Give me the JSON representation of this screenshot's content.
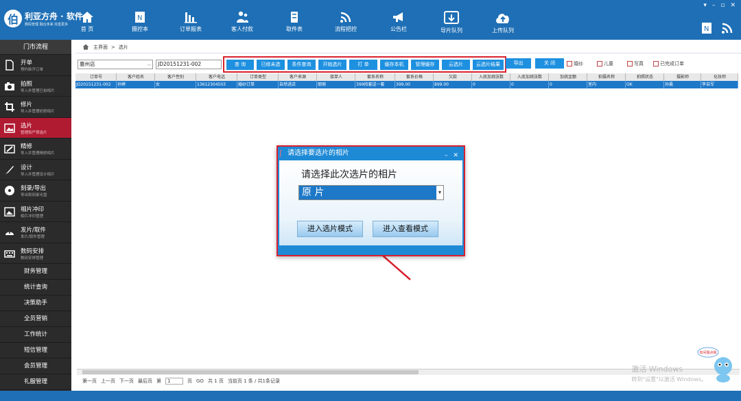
{
  "window": {
    "logo_char": "伯",
    "app_name": "利亚方舟 · 软件",
    "app_slogan": "数码管理 融合未来 完善更多",
    "controls": [
      "▾",
      "–",
      "▫",
      "✕"
    ]
  },
  "nav": [
    {
      "label": "首 页",
      "icon": "home-icon"
    },
    {
      "label": "摄控本",
      "icon": "notebook-icon"
    },
    {
      "label": "订单报表",
      "icon": "bar-chart-icon"
    },
    {
      "label": "客人付款",
      "icon": "people-icon"
    },
    {
      "label": "取件表",
      "icon": "cabinet-icon"
    },
    {
      "label": "流程把控",
      "icon": "signal-icon"
    },
    {
      "label": "公告栏",
      "icon": "megaphone-icon"
    },
    {
      "label": "导片队列",
      "icon": "export-queue-icon"
    },
    {
      "label": "上传队列",
      "icon": "cloud-upload-icon"
    }
  ],
  "sidebar": {
    "top_label": "门市流程",
    "items": [
      {
        "label": "开单",
        "sub": "预约新开订单",
        "icon": "document-icon"
      },
      {
        "label": "拍照",
        "sub": "导入并管理已拍相片",
        "icon": "camera-icon"
      },
      {
        "label": "修片",
        "sub": "导入并管理初修相片",
        "icon": "crop-icon"
      },
      {
        "label": "选片",
        "sub": "管理和严筛选片",
        "icon": "photo-select-icon"
      },
      {
        "label": "精修",
        "sub": "导入并管理精修相片",
        "icon": "retouch-icon"
      },
      {
        "label": "设计",
        "sub": "导入并管理设计相片",
        "icon": "brush-icon"
      },
      {
        "label": "刻录/导出",
        "sub": "导出和刻录光盘",
        "icon": "disc-icon"
      },
      {
        "label": "相片冲印",
        "sub": "相片冲印管理",
        "icon": "print-icon"
      },
      {
        "label": "发片/取件",
        "sub": "发片/取件管理",
        "icon": "delivery-icon"
      },
      {
        "label": "数码安排",
        "sub": "数码安排管理",
        "icon": "keyboard-icon"
      }
    ],
    "simple_items": [
      "财务管理",
      "统计查询",
      "决策助手",
      "全员营销",
      "工作统计",
      "短信管理",
      "会员管理",
      "礼服管理"
    ]
  },
  "breadcrumb": {
    "home": "主界面",
    "sep": ">",
    "current": "选片"
  },
  "toolbar": {
    "store": "惠州店",
    "order_no": "JD20151231-002",
    "buttons": [
      "查 询",
      "已修未选",
      "条件查询",
      "开始选片",
      "打 单",
      "缓存本机",
      "管理缓存",
      "云选片",
      "云选片结果"
    ],
    "extra_buttons": [
      "导出",
      "关 闭"
    ],
    "checkboxes": [
      "婚纱",
      "儿童",
      "写真",
      "已完成订单"
    ]
  },
  "grid": {
    "columns": [
      "订单号",
      "客户姓名",
      "客户性别",
      "客户电话",
      "订单类型",
      "客户来源",
      "接单人",
      "套系名称",
      "套系价格",
      "欠款",
      "入底加挑张数",
      "入底加挑张数",
      "加挑金额",
      "拍摄名称",
      "拍照状态",
      "摄影师",
      "化妆师"
    ],
    "rows": [
      [
        "JD20151231-002",
        "孙婷",
        "女",
        "13612304503",
        "婚纱订单",
        "自然进店",
        "丽丽",
        "399拍套送一套",
        "399.00",
        "899.00",
        "0",
        "0",
        "0",
        "室内",
        "OK",
        "孙晨",
        "李自军"
      ]
    ]
  },
  "pager": {
    "first": "第一页",
    "prev": "上一页",
    "next": "下一页",
    "last": "最后页",
    "page_prefix": "第",
    "page_value": "1",
    "page_suffix": "页",
    "go": "GO",
    "total_pages": "共 1 页",
    "current_info": "当前页 1 条 / 共1条记录"
  },
  "dialog": {
    "title": "请选择要选片的相片",
    "question": "请选择此次选片的相片",
    "selected_option": "原  片",
    "enter_select": "进入选片模式",
    "enter_view": "进入查看模式",
    "controls": [
      "–",
      "✕"
    ]
  },
  "watermark": {
    "line1": "激活 Windows",
    "line2": "转到\"设置\"以激活 Windows。"
  },
  "mascot_text": "有问题点我",
  "colors": {
    "brand_blue": "#1e6fb5",
    "button_blue": "#1e90e0",
    "active_red": "#b01b32",
    "highlight_red": "#d9202e",
    "sidebar_dark": "#2b2b2b"
  }
}
